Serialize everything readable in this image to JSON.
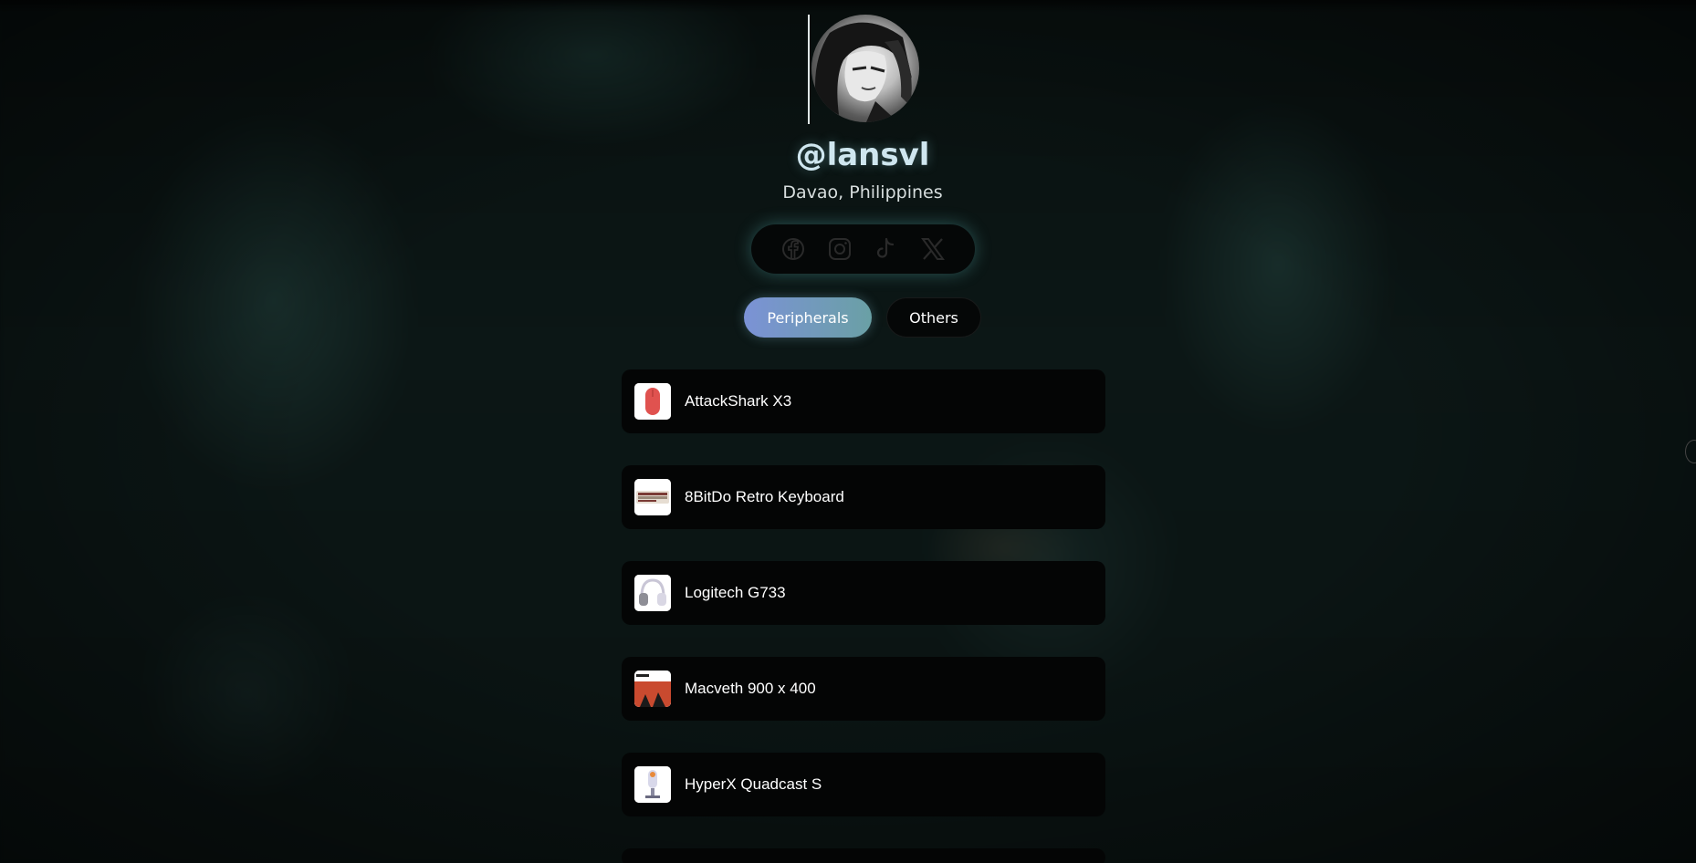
{
  "profile": {
    "username": "@lansvl",
    "location": "Davao, Philippines"
  },
  "socials": [
    {
      "icon": "facebook-icon",
      "label": "Facebook"
    },
    {
      "icon": "instagram-icon",
      "label": "Instagram"
    },
    {
      "icon": "tiktok-icon",
      "label": "TikTok"
    },
    {
      "icon": "x-icon",
      "label": "X"
    }
  ],
  "tabs": [
    {
      "label": "Peripherals",
      "active": true
    },
    {
      "label": "Others",
      "active": false
    }
  ],
  "items": [
    {
      "label": "AttackShark X3",
      "thumb": "mouse-thumbnail"
    },
    {
      "label": "8BitDo Retro Keyboard",
      "thumb": "keyboard-thumbnail"
    },
    {
      "label": "Logitech G733",
      "thumb": "headset-thumbnail"
    },
    {
      "label": "Macveth 900 x 400",
      "thumb": "mousepad-thumbnail"
    },
    {
      "label": "HyperX Quadcast S",
      "thumb": "microphone-thumbnail"
    }
  ],
  "colors": {
    "accent_start": "#7b92d6",
    "accent_end": "#6aa0a5",
    "username": "#cfe6ef",
    "card_bg": "#040505"
  }
}
